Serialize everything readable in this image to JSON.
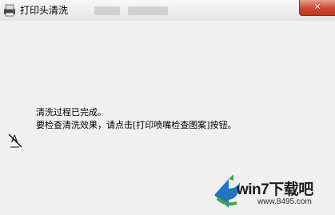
{
  "window": {
    "title": "打印头清洗",
    "close_label": "✕"
  },
  "icons": {
    "app": "printer-icon",
    "status": "printhead-clean-icon"
  },
  "message": {
    "line1": "清洗过程已完成。",
    "line2": "要检查清洗效果，请点击[打印喷嘴检查图案]按钮。"
  },
  "watermark": {
    "brand": "win7下载吧",
    "url": "www.8495.com"
  },
  "colors": {
    "close_button": "#c7412a",
    "logo_blue": "#1f74c4",
    "logo_green": "#3aa845"
  }
}
